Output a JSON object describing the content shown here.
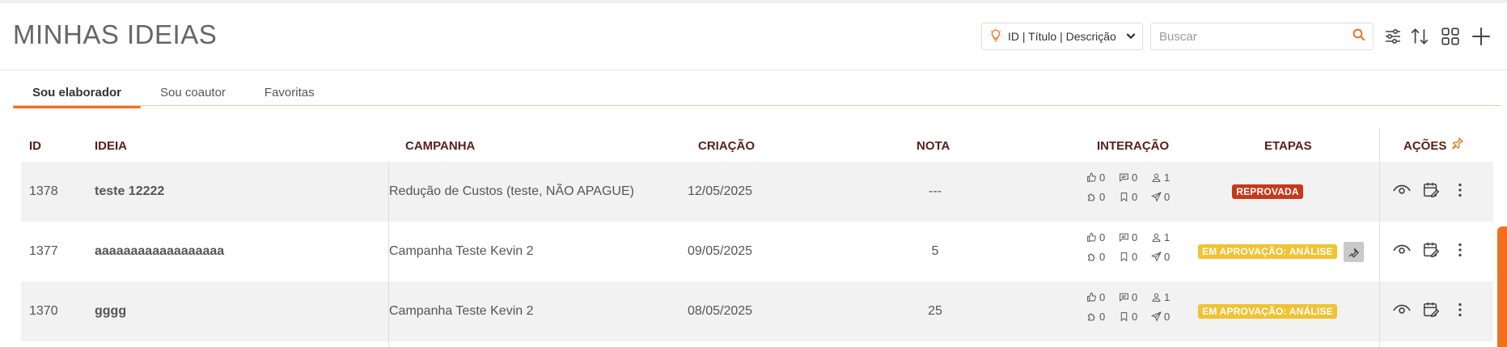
{
  "page": {
    "title": "MINHAS IDEIAS"
  },
  "toolbar": {
    "field_select_label": "ID | Título | Descrição",
    "search_placeholder": "Buscar",
    "icons": [
      "bulb-icon",
      "chevron-down-icon",
      "search-icon",
      "filter-sliders-icon",
      "sort-icon",
      "grid-view-icon",
      "add-icon"
    ]
  },
  "tabs": [
    {
      "label": "Sou elaborador",
      "active": true
    },
    {
      "label": "Sou coautor",
      "active": false
    },
    {
      "label": "Favoritas",
      "active": false
    }
  ],
  "table": {
    "headers": {
      "id": "ID",
      "ideia": "IDEIA",
      "campanha": "CAMPANHA",
      "criacao": "CRIAÇÃO",
      "nota": "NOTA",
      "interacao": "INTERAÇÃO",
      "etapas": "ETAPAS",
      "acoes": "AÇÕES"
    },
    "rows": [
      {
        "id": "1378",
        "ideia": "teste 12222",
        "campanha": "Redução de Custos (teste, NÃO APAGUE)",
        "criacao": "12/05/2025",
        "nota": "---",
        "likes": "0",
        "comments": "0",
        "coauthors": "1",
        "puzzle": "0",
        "bookmarks": "0",
        "shares": "0",
        "etapa": "REPROVADA",
        "etapa_color": "#c8381b"
      },
      {
        "id": "1377",
        "ideia": "aaaaaaaaaaaaaaaaaa",
        "campanha": "Campanha Teste Kevin 2",
        "criacao": "09/05/2025",
        "nota": "5",
        "likes": "0",
        "comments": "0",
        "coauthors": "1",
        "puzzle": "0",
        "bookmarks": "0",
        "shares": "0",
        "etapa": "EM APROVAÇÃO: ANÁLISE",
        "etapa_color": "#f1c232"
      },
      {
        "id": "1370",
        "ideia": "gggg",
        "campanha": "Campanha Teste Kevin 2",
        "criacao": "08/05/2025",
        "nota": "25",
        "likes": "0",
        "comments": "0",
        "coauthors": "1",
        "puzzle": "0",
        "bookmarks": "0",
        "shares": "0",
        "etapa": "EM APROVAÇÃO: ANÁLISE",
        "etapa_color": "#f1c232"
      }
    ]
  },
  "colors": {
    "accent": "#f07020",
    "header_text": "#5a1f16",
    "stripe": "#f2f2f2"
  }
}
